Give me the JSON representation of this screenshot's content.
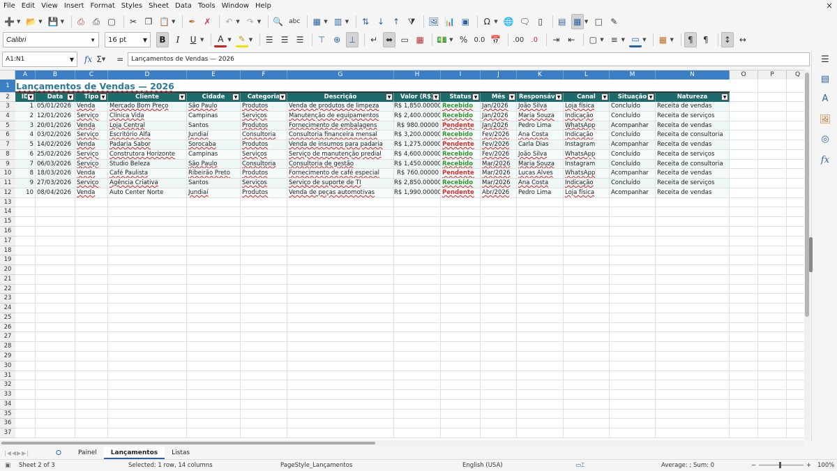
{
  "menubar": {
    "items": [
      "File",
      "Edit",
      "View",
      "Insert",
      "Format",
      "Styles",
      "Sheet",
      "Data",
      "Tools",
      "Window",
      "Help"
    ],
    "close": "×"
  },
  "toolbar": {
    "font_name": "Calibri",
    "font_size": "16 pt"
  },
  "formula_bar": {
    "cell_ref": "A1:N1",
    "content": "Lançamentos de Vendas — 2026"
  },
  "columns": [
    "A",
    "B",
    "C",
    "D",
    "E",
    "F",
    "G",
    "H",
    "I",
    "J",
    "K",
    "L",
    "M",
    "N",
    "O",
    "P",
    "Q"
  ],
  "row_numbers": [
    "1",
    "2",
    "3",
    "4",
    "5",
    "6",
    "7",
    "8",
    "9",
    "10",
    "11",
    "12",
    "13",
    "14",
    "15",
    "16",
    "17",
    "18",
    "19",
    "20",
    "21",
    "22",
    "23",
    "24",
    "25",
    "26",
    "27",
    "28",
    "29",
    "30",
    "31",
    "32",
    "33",
    "34",
    "35",
    "36",
    "37"
  ],
  "sheet_title": "Lançamentos de Vendas — 2026",
  "table": {
    "headers": [
      "ID",
      "Data",
      "Tipo",
      "Cliente",
      "Cidade",
      "Categoria",
      "Descrição",
      "Valor (R$)",
      "Status",
      "Mês",
      "Responsável",
      "Canal",
      "Situação",
      "Natureza"
    ],
    "rows": [
      [
        "1",
        "05/01/2026",
        "Venda",
        "Mercado Bom Preço",
        "São Paulo",
        "Produtos",
        "Venda de produtos de limpeza",
        "R$ 1,850.00000",
        "Recebido",
        "Jan/2026",
        "João Silva",
        "Loja física",
        "Concluído",
        "Receita de vendas"
      ],
      [
        "2",
        "12/01/2026",
        "Serviço",
        "Clínica Vida",
        "Campinas",
        "Serviços",
        "Manutenção de equipamentos",
        "R$ 2,400.00000",
        "Recebido",
        "Jan/2026",
        "Maria Souza",
        "Indicação",
        "Concluído",
        "Receita de serviços"
      ],
      [
        "3",
        "20/01/2026",
        "Venda",
        "Loja Central",
        "Santos",
        "Produtos",
        "Fornecimento de embalagens",
        "R$ 980.00000",
        "Pendente",
        "Jan/2026",
        "Pedro Lima",
        "WhatsApp",
        "Acompanhar",
        "Receita de vendas"
      ],
      [
        "4",
        "03/02/2026",
        "Serviço",
        "Escritório Alfa",
        "Jundiaí",
        "Consultoria",
        "Consultoria financeira mensal",
        "R$ 3,200.00000",
        "Recebido",
        "Fev/2026",
        "Ana Costa",
        "Indicação",
        "Concluído",
        "Receita de consultoria"
      ],
      [
        "5",
        "14/02/2026",
        "Venda",
        "Padaria Sabor",
        "Sorocaba",
        "Produtos",
        "Venda de insumos para padaria",
        "R$ 1,275.00000",
        "Pendente",
        "Fev/2026",
        "Carla Dias",
        "Instagram",
        "Acompanhar",
        "Receita de vendas"
      ],
      [
        "6",
        "25/02/2026",
        "Serviço",
        "Construtora Horizonte",
        "Campinas",
        "Serviços",
        "Serviço de manutenção predial",
        "R$ 4,600.00000",
        "Recebido",
        "Fev/2026",
        "João Silva",
        "WhatsApp",
        "Concluído",
        "Receita de serviços"
      ],
      [
        "7",
        "06/03/2026",
        "Serviço",
        "Studio Beleza",
        "São Paulo",
        "Consultoria",
        "Consultoria de gestão",
        "R$ 1,450.00000",
        "Recebido",
        "Mar/2026",
        "Maria Souza",
        "Instagram",
        "Concluído",
        "Receita de consultoria"
      ],
      [
        "8",
        "18/03/2026",
        "Venda",
        "Café Paulista",
        "Ribeirão Preto",
        "Produtos",
        "Fornecimento de café especial",
        "R$ 760.00000",
        "Pendente",
        "Mar/2026",
        "Lucas Alves",
        "WhatsApp",
        "Acompanhar",
        "Receita de vendas"
      ],
      [
        "9",
        "27/03/2026",
        "Serviço",
        "Agência Criativa",
        "Santos",
        "Serviços",
        "Serviço de suporte de TI",
        "R$ 2,850.00000",
        "Recebido",
        "Mar/2026",
        "Ana Costa",
        "Indicação",
        "Concluído",
        "Receita de serviços"
      ],
      [
        "10",
        "08/04/2026",
        "Venda",
        "Auto Center Norte",
        "Jundiaí",
        "Produtos",
        "Venda de peças automotivas",
        "R$ 1,990.00000",
        "Pendente",
        "Abr/2026",
        "Pedro Lima",
        "Loja física",
        "Acompanhar",
        "Receita de vendas"
      ]
    ]
  },
  "colors": {
    "header_fill": "#1e6b6b",
    "title_text": "#2a7a9a",
    "received": "#2e9a2e",
    "pending": "#d03030",
    "accent": "#2a62a6"
  },
  "sheet_tabs": [
    "Painel",
    "Lançamentos",
    "Listas"
  ],
  "active_tab": "Lançamentos",
  "status": {
    "sheet": "Sheet 2 of 3",
    "selection": "Selected: 1 row, 14 columns",
    "page_style": "PageStyle_Lançamentos",
    "language": "English (USA)",
    "sum": "Average: ; Sum: 0",
    "zoom": "100%"
  }
}
